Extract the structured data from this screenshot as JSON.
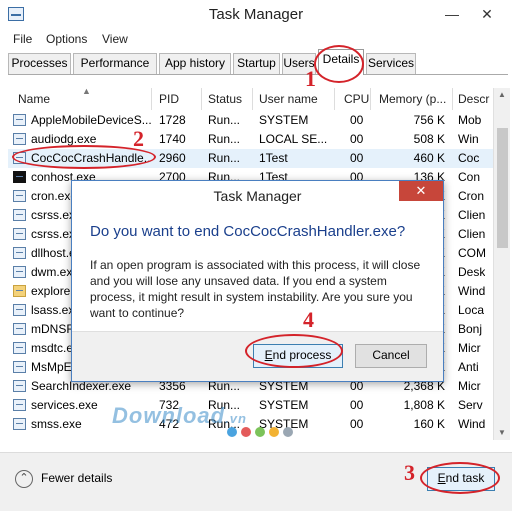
{
  "window": {
    "title": "Task Manager",
    "minimize": "—",
    "close": "✕"
  },
  "menu": [
    "File",
    "Options",
    "View"
  ],
  "tabs": [
    "Processes",
    "Performance",
    "App history",
    "Startup",
    "Users",
    "Details",
    "Services"
  ],
  "active_tab": "Details",
  "columns": [
    "Name",
    "PID",
    "Status",
    "User name",
    "CPU",
    "Memory (p...",
    "Descr"
  ],
  "rows": [
    {
      "name": "AppleMobileDeviceS...",
      "pid": "1728",
      "status": "Run...",
      "user": "SYSTEM",
      "cpu": "00",
      "mem": "756 K",
      "desc": "Mob"
    },
    {
      "name": "audiodg.exe",
      "pid": "1740",
      "status": "Run...",
      "user": "LOCAL SE...",
      "cpu": "00",
      "mem": "508 K",
      "desc": "Win"
    },
    {
      "name": "CocCocCrashHandle...",
      "pid": "2960",
      "status": "Run...",
      "user": "1Test",
      "cpu": "00",
      "mem": "460 K",
      "desc": "Coc"
    },
    {
      "name": "conhost.exe",
      "pid": "2700",
      "status": "Run...",
      "user": "1Test",
      "cpu": "00",
      "mem": "136 K",
      "desc": "Con"
    },
    {
      "name": "cron.exe",
      "pid": "",
      "status": "",
      "user": "",
      "cpu": "",
      "mem": "K",
      "desc": "Cron"
    },
    {
      "name": "csrss.exe",
      "pid": "",
      "status": "",
      "user": "",
      "cpu": "",
      "mem": "K",
      "desc": "Clien"
    },
    {
      "name": "csrss.exe",
      "pid": "",
      "status": "",
      "user": "",
      "cpu": "",
      "mem": "K",
      "desc": "Clien"
    },
    {
      "name": "dllhost.exe",
      "pid": "",
      "status": "",
      "user": "",
      "cpu": "",
      "mem": "K",
      "desc": "COM"
    },
    {
      "name": "dwm.exe",
      "pid": "",
      "status": "",
      "user": "",
      "cpu": "",
      "mem": "K",
      "desc": "Desk"
    },
    {
      "name": "explorer.exe",
      "pid": "",
      "status": "",
      "user": "",
      "cpu": "",
      "mem": "K",
      "desc": "Wind"
    },
    {
      "name": "lsass.exe",
      "pid": "",
      "status": "",
      "user": "",
      "cpu": "",
      "mem": "K",
      "desc": "Loca"
    },
    {
      "name": "mDNSResponder.exe",
      "pid": "",
      "status": "",
      "user": "",
      "cpu": "",
      "mem": "K",
      "desc": "Bonj"
    },
    {
      "name": "msdtc.exe",
      "pid": "",
      "status": "",
      "user": "",
      "cpu": "",
      "mem": "K",
      "desc": "Micr"
    },
    {
      "name": "MsMpEng.exe",
      "pid": "",
      "status": "",
      "user": "",
      "cpu": "",
      "mem": "K",
      "desc": "Anti"
    },
    {
      "name": "SearchIndexer.exe",
      "pid": "3356",
      "status": "Run...",
      "user": "SYSTEM",
      "cpu": "00",
      "mem": "2,368 K",
      "desc": "Micr"
    },
    {
      "name": "services.exe",
      "pid": "732",
      "status": "Run...",
      "user": "SYSTEM",
      "cpu": "00",
      "mem": "1,808 K",
      "desc": "Serv"
    },
    {
      "name": "smss.exe",
      "pid": "472",
      "status": "Run...",
      "user": "SYSTEM",
      "cpu": "00",
      "mem": "160 K",
      "desc": "Wind"
    }
  ],
  "footer": {
    "fewer_details": "Fewer details",
    "end_task_u": "E",
    "end_task_rest": "nd task"
  },
  "dialog": {
    "title": "Task Manager",
    "close": "✕",
    "heading": "Do you want to end CocCocCrashHandler.exe?",
    "message": "If an open program is associated with this process, it will close and you will lose any unsaved data. If you end a system process, it might result in system instability. Are you sure you want to continue?",
    "end_process_u": "E",
    "end_process_rest": "nd process",
    "cancel": "Cancel"
  },
  "callouts": [
    "1",
    "2",
    "3",
    "4"
  ],
  "watermark": {
    "text": "Download",
    "suffix": ".vn",
    "dot_colors": [
      "#4aa3df",
      "#e35b5b",
      "#7cc35a",
      "#f2b233",
      "#9aa7b3"
    ]
  }
}
